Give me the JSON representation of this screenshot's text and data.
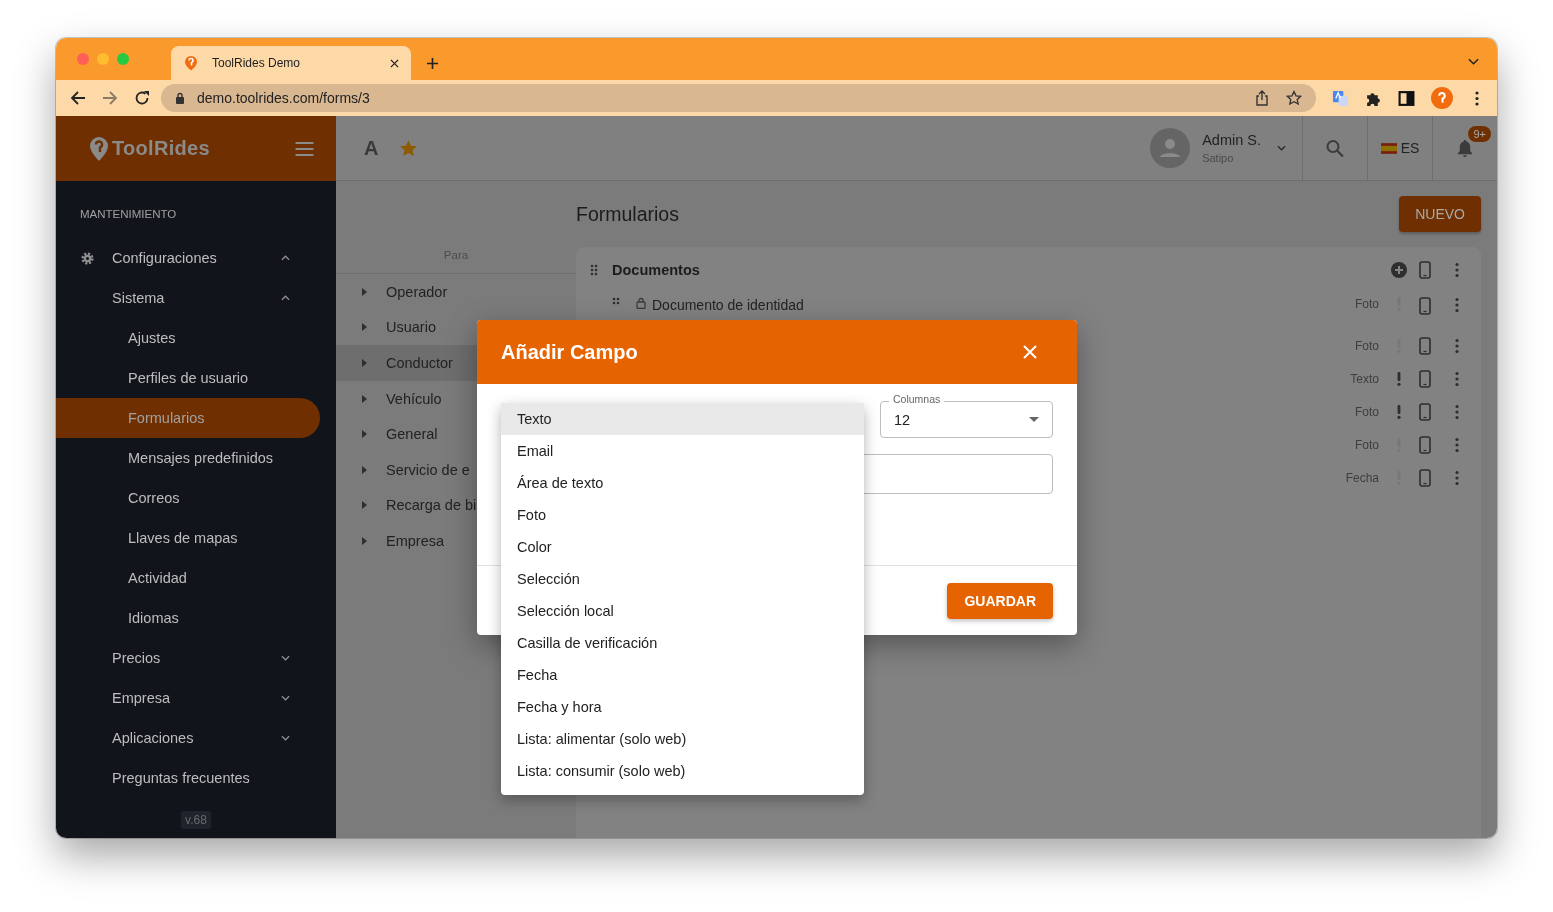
{
  "browser": {
    "tab_title": "ToolRides Demo",
    "url": "demo.toolrides.com/forms/3"
  },
  "sidebar": {
    "brand": "ToolRides",
    "section": "MANTENIMIENTO",
    "items": [
      {
        "label": "Configuraciones",
        "expanded": true,
        "selected": false,
        "children": [
          {
            "label": "Sistema",
            "expanded": true,
            "selected": false,
            "children": [
              {
                "label": "Ajustes",
                "selected": false
              },
              {
                "label": "Perfiles de usuario",
                "selected": false
              },
              {
                "label": "Formularios",
                "selected": true
              },
              {
                "label": "Mensajes predefinidos",
                "selected": false
              },
              {
                "label": "Correos",
                "selected": false
              },
              {
                "label": "Llaves de mapas",
                "selected": false
              },
              {
                "label": "Actividad",
                "selected": false
              },
              {
                "label": "Idiomas",
                "selected": false
              }
            ]
          },
          {
            "label": "Precios",
            "expanded": false,
            "selected": false
          },
          {
            "label": "Empresa",
            "expanded": false,
            "selected": false
          },
          {
            "label": "Aplicaciones",
            "expanded": false,
            "selected": false
          },
          {
            "label": "Preguntas frecuentes",
            "selected": false
          }
        ]
      }
    ],
    "version": "v.68"
  },
  "topbar": {
    "font_button": "A",
    "user": {
      "name": "Admin S.",
      "place": "Satipo"
    },
    "language": "ES",
    "notifications": "9+"
  },
  "page": {
    "title": "Formularios",
    "new_button": "NUEVO"
  },
  "targets": {
    "header": "Para",
    "items": [
      {
        "label": "Operador",
        "selected": false
      },
      {
        "label": "Usuario",
        "selected": false
      },
      {
        "label": "Conductor",
        "selected": true
      },
      {
        "label": "Vehículo",
        "selected": false
      },
      {
        "label": "General",
        "selected": false
      },
      {
        "label": "Servicio de e",
        "selected": false
      },
      {
        "label": "Recarga de bi",
        "selected": false
      },
      {
        "label": "Empresa",
        "selected": false
      }
    ]
  },
  "card": {
    "title": "Documentos",
    "fields": [
      {
        "name": "Documento de identidad",
        "type": "Foto",
        "required": false
      },
      {
        "type": "Foto",
        "required": false
      },
      {
        "type": "Texto",
        "required": true
      },
      {
        "type": "Foto",
        "required": true
      },
      {
        "type": "Foto",
        "required": false
      },
      {
        "type": "Fecha",
        "required": false
      }
    ]
  },
  "dialog": {
    "title": "Añadir Campo",
    "columns": {
      "label": "Columnas",
      "value": "12"
    },
    "options": [
      {
        "label": "Texto",
        "selected": true
      },
      {
        "label": "Email",
        "selected": false
      },
      {
        "label": "Área de texto",
        "selected": false
      },
      {
        "label": "Foto",
        "selected": false
      },
      {
        "label": "Color",
        "selected": false
      },
      {
        "label": "Selección",
        "selected": false
      },
      {
        "label": "Selección local",
        "selected": false
      },
      {
        "label": "Casilla de verificación",
        "selected": false
      },
      {
        "label": "Fecha",
        "selected": false
      },
      {
        "label": "Fecha y hora",
        "selected": false
      },
      {
        "label": "Lista: alimentar (solo web)",
        "selected": false
      },
      {
        "label": "Lista: consumir (solo web)",
        "selected": false
      }
    ],
    "save_button": "GUARDAR"
  }
}
